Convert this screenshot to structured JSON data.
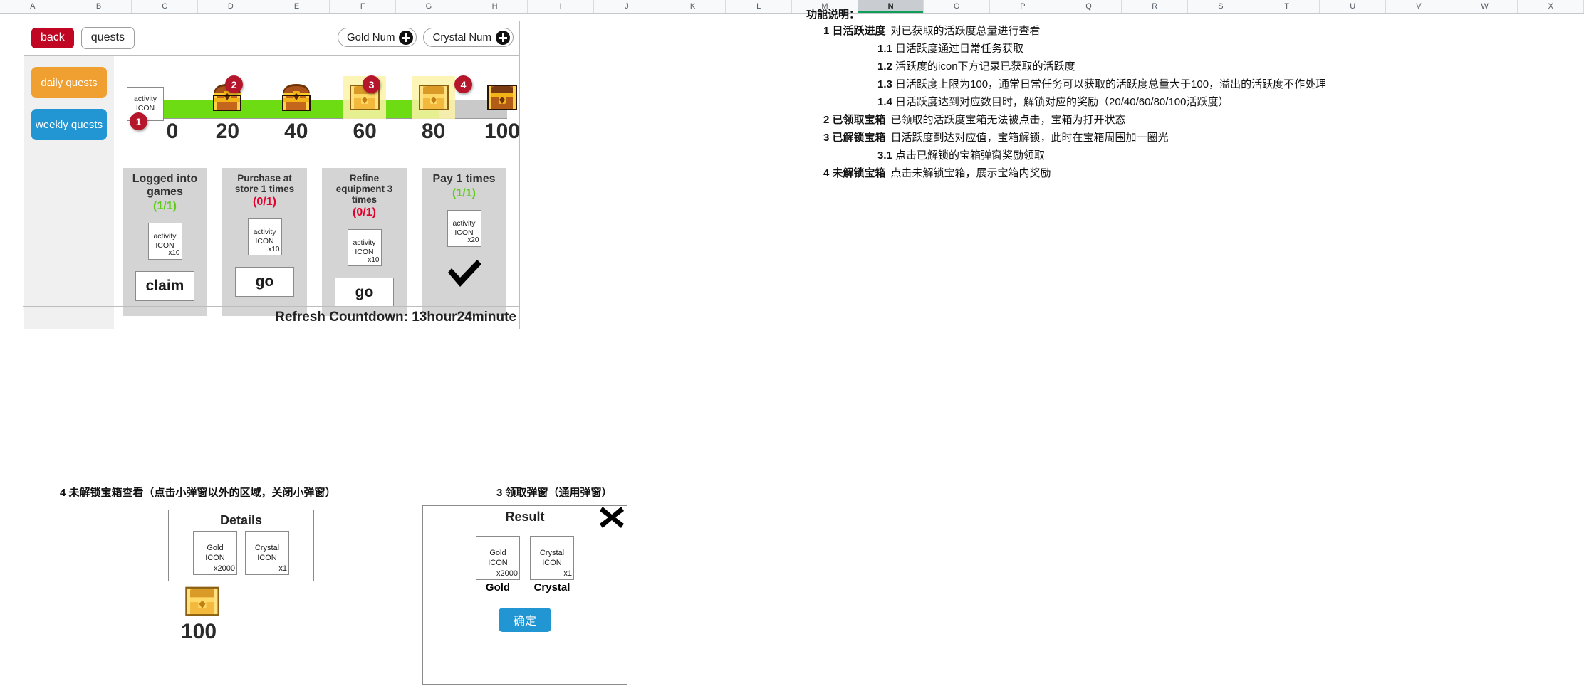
{
  "spreadsheet": {
    "columns": [
      "A",
      "B",
      "C",
      "D",
      "E",
      "F",
      "G",
      "H",
      "I",
      "J",
      "K",
      "L",
      "M",
      "N",
      "O",
      "P",
      "Q",
      "R",
      "S",
      "T",
      "U",
      "V",
      "W",
      "X"
    ],
    "active_column": "N"
  },
  "app": {
    "topbar": {
      "back_label": "back",
      "quests_label": "quests",
      "gold_label": "Gold Num",
      "crystal_label": "Crystal Num",
      "plus_icon": "plus-circle-icon"
    },
    "sidebar": {
      "items": [
        {
          "label": "daily quests",
          "color": "#f0a030"
        },
        {
          "label": "weekly quests",
          "color": "#2196d3"
        }
      ]
    },
    "progress": {
      "activity_icon_line1": "activity",
      "activity_icon_line2": "ICON",
      "ticks": [
        "0",
        "20",
        "40",
        "60",
        "80",
        "100"
      ],
      "current_value": 80,
      "max_value": 100,
      "fill_color": "#6ddc12",
      "track_color": "#c9c9c9",
      "glow_color": "#fbf3a8",
      "badges": [
        {
          "num": "1",
          "target": "activity-icon"
        },
        {
          "num": "2",
          "target": "chest-20"
        },
        {
          "num": "3",
          "target": "chest-60"
        },
        {
          "num": "4",
          "target": "chest-100"
        }
      ],
      "chests": [
        {
          "tick": "20",
          "state": "claimed",
          "glow": false
        },
        {
          "tick": "40",
          "state": "claimed",
          "glow": false
        },
        {
          "tick": "60",
          "state": "unlocked",
          "glow": true
        },
        {
          "tick": "80",
          "state": "unlocked",
          "glow": true
        },
        {
          "tick": "100",
          "state": "locked",
          "glow": false
        }
      ]
    },
    "cards": [
      {
        "title": "Logged into games",
        "count": "(1/1)",
        "count_state": "done",
        "reward_line1": "activity",
        "reward_line2": "ICON",
        "reward_qty": "x10",
        "action_label": "claim",
        "action_type": "button"
      },
      {
        "title": "Purchase at store 1 times",
        "count": "(0/1)",
        "count_state": "pending",
        "reward_line1": "activity",
        "reward_line2": "ICON",
        "reward_qty": "x10",
        "action_label": "go",
        "action_type": "button"
      },
      {
        "title": "Refine equipment 3 times",
        "count": "(0/1)",
        "count_state": "pending",
        "reward_line1": "activity",
        "reward_line2": "ICON",
        "reward_qty": "x10",
        "action_label": "go",
        "action_type": "button"
      },
      {
        "title": "Pay 1 times",
        "count": "(1/1)",
        "count_state": "done",
        "reward_line1": "activity",
        "reward_line2": "ICON",
        "reward_qty": "x20",
        "action_label": "",
        "action_type": "check-icon"
      }
    ],
    "refresh": {
      "label": "Refresh Countdown:",
      "value": "13hour24minute"
    }
  },
  "popups": {
    "details": {
      "caption": "4 未解锁宝箱查看（点击小弹窗以外的区域，关闭小弹窗）",
      "title": "Details",
      "items": [
        {
          "line1": "Gold",
          "line2": "ICON",
          "qty": "x2000"
        },
        {
          "line1": "Crystal",
          "line2": "ICON",
          "qty": "x1"
        }
      ],
      "chest_value": "100",
      "chest_icon": "treasure-chest-icon"
    },
    "result": {
      "caption": "3 领取弹窗（通用弹窗）",
      "title": "Result",
      "close_icon": "close-x-icon",
      "items": [
        {
          "line1": "Gold",
          "line2": "ICON",
          "qty": "x2000",
          "name": "Gold"
        },
        {
          "line1": "Crystal",
          "line2": "ICON",
          "qty": "x1",
          "name": "Crystal"
        }
      ],
      "confirm_label": "确定"
    }
  },
  "doc": {
    "title": "功能说明：",
    "lines": [
      {
        "indent": 1,
        "num": "1",
        "term": "日活跃进度",
        "text": "对已获取的活跃度总量进行查看"
      },
      {
        "indent": 2,
        "num": "1.1",
        "term": "",
        "text": "日活跃度通过日常任务获取"
      },
      {
        "indent": 2,
        "num": "1.2",
        "term": "",
        "text": "活跃度的icon下方记录已获取的活跃度"
      },
      {
        "indent": 2,
        "num": "1.3",
        "term": "",
        "text": "日活跃度上限为100，通常日常任务可以获取的活跃度总量大于100，溢出的活跃度不作处理"
      },
      {
        "indent": 2,
        "num": "1.4",
        "term": "",
        "text": "日活跃度达到对应数目时，解锁对应的奖励（20/40/60/80/100活跃度）"
      },
      {
        "indent": 1,
        "num": "2",
        "term": "已领取宝箱",
        "text": "已领取的活跃度宝箱无法被点击，宝箱为打开状态"
      },
      {
        "indent": 1,
        "num": "3",
        "term": "已解锁宝箱",
        "text": "日活跃度到达对应值，宝箱解锁，此时在宝箱周围加一圈光"
      },
      {
        "indent": 2,
        "num": "3.1",
        "term": "",
        "text": "点击已解锁的宝箱弹窗奖励领取"
      },
      {
        "indent": 1,
        "num": "4",
        "term": "未解锁宝箱",
        "text": "点击未解锁宝箱，展示宝箱内奖励"
      }
    ]
  }
}
